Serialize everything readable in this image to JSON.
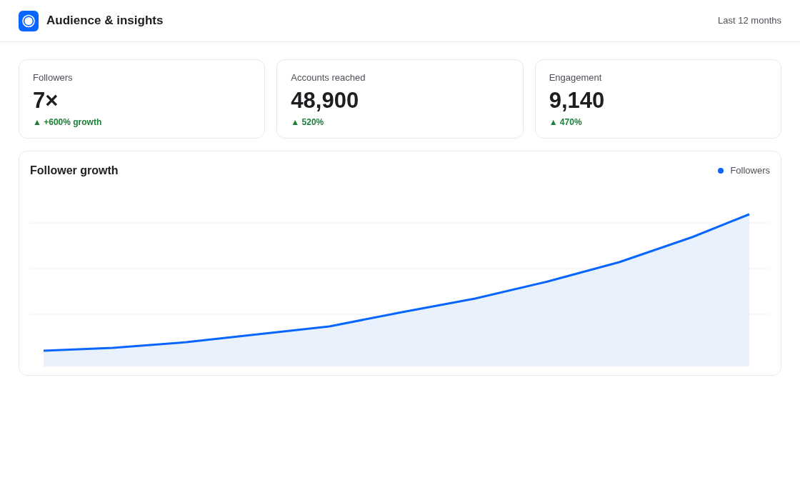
{
  "header": {
    "title": "Audience & insights",
    "period": "Last 12 months"
  },
  "stats": [
    {
      "label": "Followers",
      "value": "7×",
      "change": "▲ +600% growth"
    },
    {
      "label": "Accounts reached",
      "value": "48,900",
      "change": "▲ 520%"
    },
    {
      "label": "Engagement",
      "value": "9,140",
      "change": "▲ 470%"
    }
  ],
  "growth_chart": {
    "title": "Follower growth",
    "legend": [
      {
        "label": "Followers"
      }
    ]
  }
}
